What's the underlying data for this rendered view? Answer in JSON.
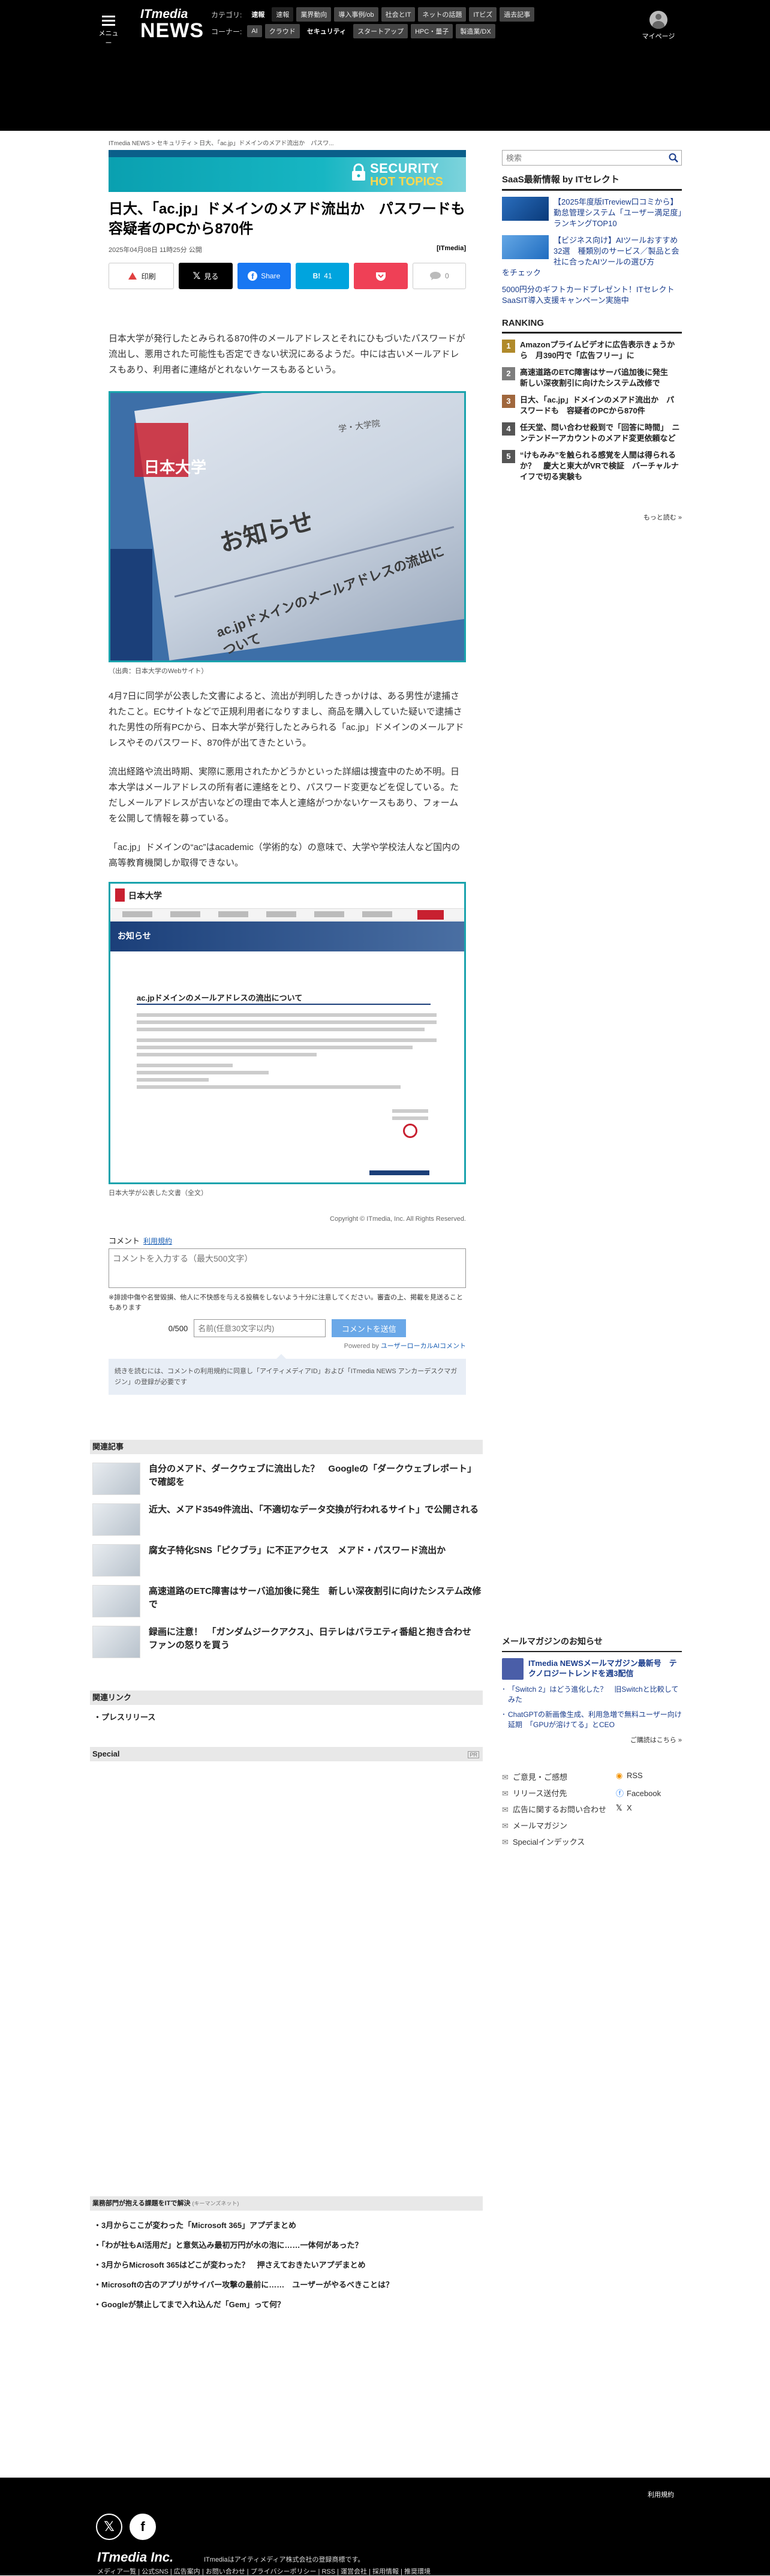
{
  "header": {
    "menu_label": "メニュー",
    "logo_it": "ITmedia",
    "logo_news": "NEWS",
    "category_label": "カテゴリ:",
    "categories": [
      "速報",
      "速報",
      "業界動向",
      "導入事例/ob",
      "社会とIT",
      "ネットの話題",
      "ITビズ",
      "過去記事"
    ],
    "corner_label": "コーナー:",
    "corners": [
      "AI",
      "クラウド",
      "セキュリティ",
      "スタートアップ",
      "HPC・量子",
      "製造業/DX"
    ],
    "mypage_label": "マイページ"
  },
  "article": {
    "breadcrumb": "ITmedia NEWS > セキュリティ > 日大、「ac.jp」ドメインのメアド流出か　パスワ...",
    "banner_line1": "SECURITY",
    "banner_line2": "HOT TOPICS",
    "title": "日大、「ac.jp」ドメインのメアド流出か　パスワードも　容疑者のPCから870件",
    "date": "2025年04月08日 11時25分 公開",
    "source": "[ITmedia]",
    "share": {
      "print": "印刷",
      "x": "見る",
      "facebook": "Share",
      "hatena": "41",
      "comment_count": "0"
    },
    "paragraphs": [
      "日本大学が発行したとみられる870件のメールアドレスとそれにひもづいたパスワードが流出し、悪用された可能性も否定できない状況にあるようだ。中には古いメールアドレスもあり、利用者に連絡がとれないケースもあるという。",
      "4月7日に同学が公表した文書によると、流出が判明したきっかけは、ある男性が逮捕されたこと。ECサイトなどで正規利用者になりすまし、商品を購入していた疑いで逮捕された男性の所有PCから、日本大学が発行したとみられる「ac.jp」ドメインのメールアドレスやそのパスワード、870件が出てきたという。",
      "流出経路や流出時期、実際に悪用されたかどうかといった詳細は捜査中のため不明。日本大学はメールアドレスの所有者に連絡をとり、パスワード変更などを促している。ただしメールアドレスが古いなどの理由で本人と連絡がつかないケースもあり、フォームを公開して情報を募っている。",
      "「ac.jp」ドメインの“ac”はacademic（学術的な）の意味で、大学や学校法人など国内の高等教育機関しか取得できない。"
    ],
    "figure1": {
      "notice_text": "お知らせ",
      "heading_text": "ac.jpドメインのメールアドレスの流出について",
      "seal_text": "日本大学",
      "top_text": "学・大学院",
      "caption": "（出典：日本大学のWebサイト）"
    },
    "figure2": {
      "logo_text": "日本大学",
      "hero_text": "お知らせ",
      "heading_text": "ac.jpドメインのメールアドレスの流出について",
      "caption": "日本大学が公表した文書（全文）"
    },
    "copyright": "Copyright © ITmedia, Inc. All Rights Reserved."
  },
  "comment": {
    "label": "コメント",
    "terms_link": "利用規約",
    "placeholder": "コメントを入力する（最大500文字）",
    "note": "※誹謗中傷や名誉毀損、他人に不快感を与える投稿をしないよう十分に注意してください。審査の上、掲載を見送ることもあります",
    "count": "0/500",
    "name_placeholder": "名前(任意30文字以内)",
    "send_label": "コメントを送信",
    "powered": "Powered by",
    "powered_link": "ユーザーローカルAIコメント",
    "info": "続きを読むには、コメントの利用規約に同意し「アイティメディアID」および「ITmedia NEWS アンカーデスクマガジン」の登録が必要です"
  },
  "sidebar": {
    "search_placeholder": "検索",
    "saas_heading": "SaaS最新情報 by ITセレクト",
    "saas_items": [
      "【2025年度版ITreview口コミから】勤怠管理システム「ユーザー満足度」ランキングTOP10",
      "【ビジネス向け】AIツールおすすめ32選　種類別のサービス／製品と会社に合ったAIツールの選び方"
    ],
    "saas_tail": "をチェック",
    "saas_link": "5000円分のギフトカードプレゼント！ITセレクトSaaSIT導入支援キャンペーン実施中",
    "ranking_heading": "RANKING",
    "ranking": [
      "Amazonプライムビデオに広告表示きょうから　月390円で「広告フリー」に",
      "高速道路のETC障害はサーバ追加後に発生　新しい深夜割引に向けたシステム改修で",
      "日大、「ac.jp」ドメインのメアド流出か　パスワードも　容疑者のPCから870件",
      "任天堂、問い合わせ殺到で「回答に時間」　ニンテンドーアカウントのメアド変更依頼など",
      "“けもみみ”を触られる感覚を人間は得られるか？　慶大と東大がVRで検証　バーチャルナイフで切る実験も"
    ],
    "ranking_more": "もっと読む »"
  },
  "related": {
    "heading": "関連記事",
    "items": [
      "自分のメアド、ダークウェブに流出した？　Googleの「ダークウェブレポート」で確認を",
      "近大、メアド3549件流出、「不適切なデータ交換が行われるサイト」で公開される",
      "腐女子特化SNS「ピクブラ」に不正アクセス　メアド・パスワード流出か",
      "高速道路のETC障害はサーバ追加後に発生　新しい深夜割引に向けたシステム改修で",
      "録画に注意！　「ガンダムジークアクス」、日テレはバラエティ番組と抱き合わせ　ファンの怒りを買う"
    ],
    "links_heading": "関連リンク",
    "links": [
      "プレスリリース"
    ],
    "special_heading": "Special",
    "special_pr": "PR"
  },
  "mail": {
    "heading": "メールマガジンのお知らせ",
    "main": "ITmedia NEWSメールマガジン最新号　テクノロジートレンドを週3配信",
    "items": [
      "「Switch 2」はどう進化した？　旧Switchと比較してみた",
      "ChatGPTの新画像生成、利用急増で無料ユーザー向け延期　「GPUが溶けてる」とCEO"
    ],
    "more": "ご購読はこちら »"
  },
  "footer_links": {
    "items": [
      "ご意見・ご感想",
      "RSS",
      "リリース送付先",
      "Facebook",
      "広告に関するお問い合わせ",
      "X",
      "メールマガジン",
      "",
      "Specialインデックス",
      ""
    ]
  },
  "bottom_list": {
    "heading": "業務部門が抱える課題をITで解決",
    "heading_sub": "(キーマンズネット)",
    "items": [
      "3月からここが変わった「Microsoft 365」アプデまとめ",
      "「わが社もAI活用だ」と意気込み最初万円が水の泡に……一体何があった？",
      "3月からMicrosoft 365はどこが変わった？　押さえておきたいアプデまとめ",
      "Microsoftの古のアプリがサイバー攻撃の最前に……　ユーザーがやるべきことは？",
      "Googleが禁止してまで入れ込んだ「Gem」って何？"
    ]
  },
  "footer": {
    "terms": "利用規約",
    "brand": "ITmedia Inc.",
    "registered": "ITmediaはアイティメディア株式会社の登録商標です。",
    "links": "メディア一覧 | 公式SNS | 広告案内 | お問い合わせ | プライバシーポリシー | RSS | 運営会社 | 採用情報 | 推奨環境"
  }
}
